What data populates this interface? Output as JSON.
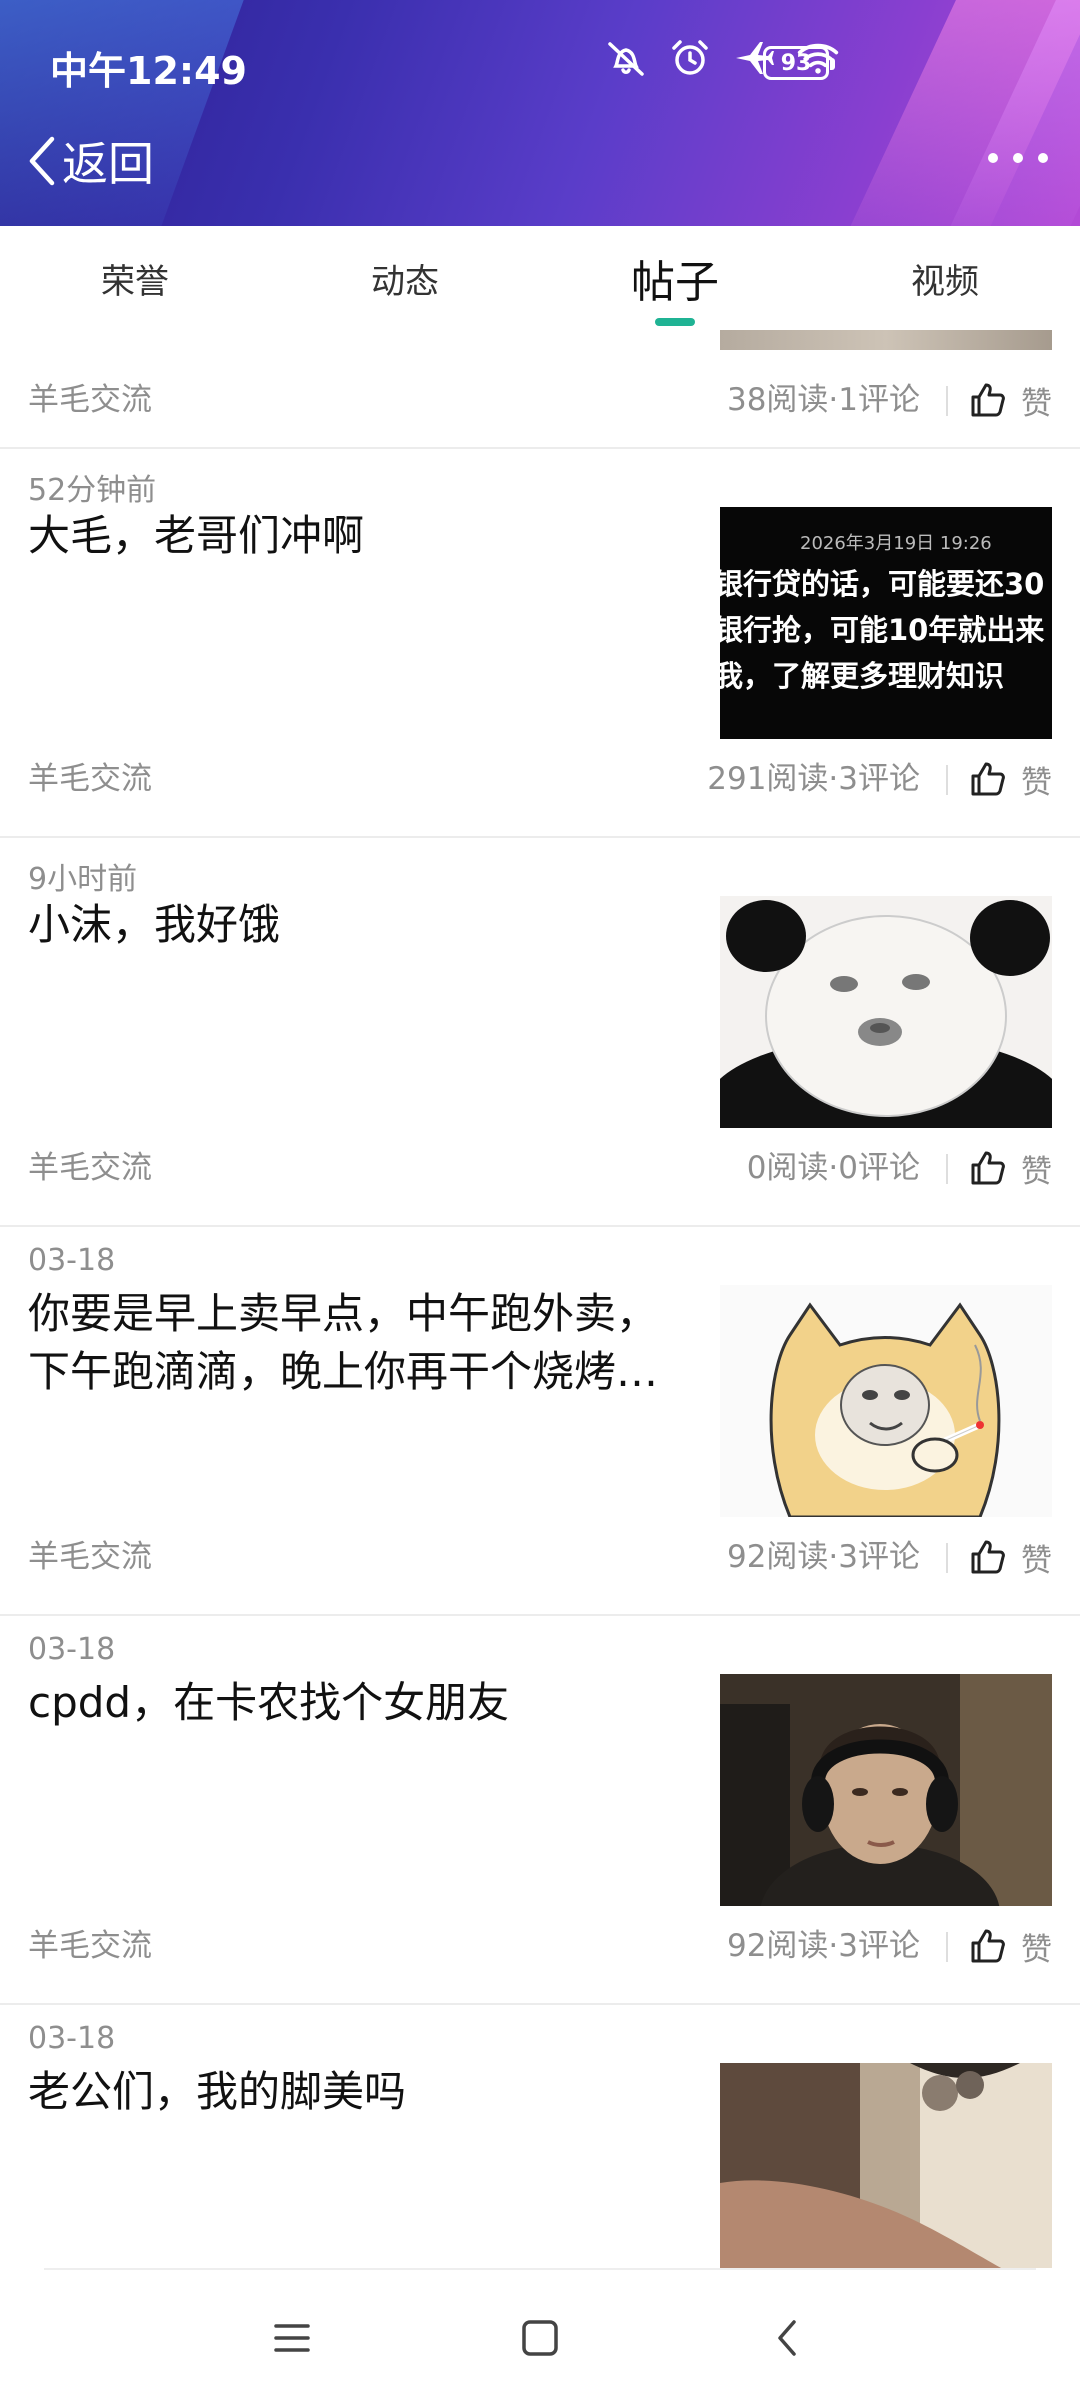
{
  "status_bar": {
    "time": "中午12:49",
    "battery": "93",
    "icons": [
      "mute-notification-icon",
      "alarm-icon",
      "airplane-mode-icon",
      "wifi-icon",
      "battery-icon"
    ]
  },
  "header": {
    "back_label": "返回",
    "more_icon": "more-dots-icon"
  },
  "tabs": [
    {
      "label": "荣誉",
      "active": false
    },
    {
      "label": "动态",
      "active": false
    },
    {
      "label": "帖子",
      "active": true
    },
    {
      "label": "视频",
      "active": false
    }
  ],
  "top_partial": {
    "category": "羊毛交流",
    "stats": "38阅读·1评论",
    "like_label": "赞"
  },
  "posts": [
    {
      "time": "52分钟前",
      "title": "大毛，老哥们冲啊",
      "thumbnail": {
        "type": "text-image",
        "date": "2026年3月19日 19:26",
        "lines": [
          "银行贷的话，可能要还30",
          "银行抢，可能10年就出来",
          "我，了解更多理财知识"
        ]
      },
      "category": "羊毛交流",
      "stats": "291阅读·3评论",
      "like_label": "赞"
    },
    {
      "time": "9小时前",
      "title": "小沫，我好饿",
      "thumbnail": {
        "type": "panda-meme"
      },
      "category": "羊毛交流",
      "stats": "0阅读·0评论",
      "like_label": "赞"
    },
    {
      "time": "03-18",
      "title": "你要是早上卖早点，中午跑外卖，下午跑滴滴，晚上你再干个烧烤…",
      "thumbnail": {
        "type": "doge-meme"
      },
      "category": "羊毛交流",
      "stats": "92阅读·3评论",
      "like_label": "赞"
    },
    {
      "time": "03-18",
      "title": "cpdd，在卡农找个女朋友",
      "thumbnail": {
        "type": "photo-person-headphones"
      },
      "category": "羊毛交流",
      "stats": "92阅读·3评论",
      "like_label": "赞"
    },
    {
      "time": "03-18",
      "title": "老公们，我的脚美吗",
      "thumbnail": {
        "type": "photo-foot"
      }
    }
  ],
  "nav": [
    "menu-icon",
    "home-icon",
    "back-icon"
  ],
  "colors": {
    "header_gradient_start": "#2a1f8f",
    "header_gradient_end": "#b34ad6",
    "tab_indicator": "#1fb394",
    "secondary_text": "#8e8e8e"
  }
}
